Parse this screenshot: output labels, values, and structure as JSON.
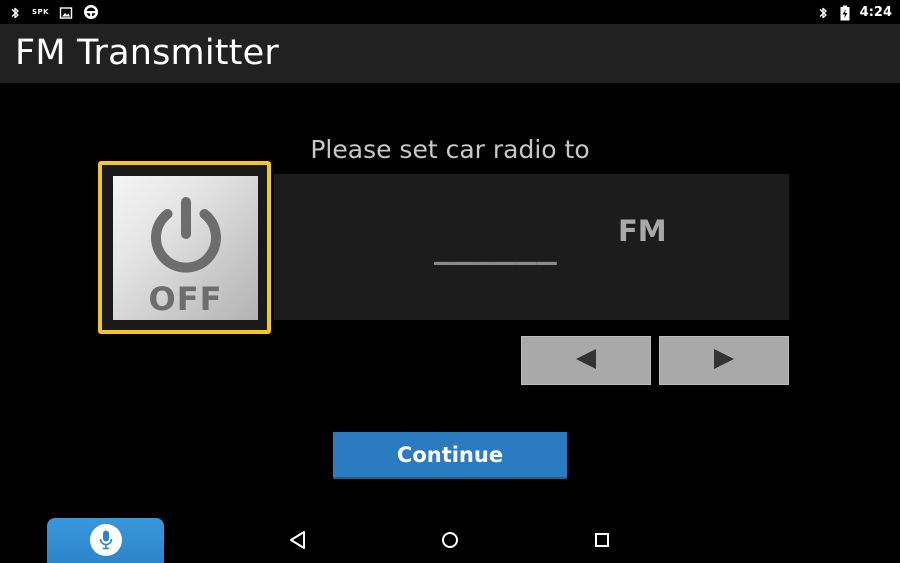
{
  "status_bar": {
    "left_icons": [
      "bluetooth-icon",
      "spk-icon",
      "image-icon",
      "steering-wheel-icon"
    ],
    "spk_text": "SPK",
    "right_icons": [
      "bluetooth-icon",
      "battery-charging-icon"
    ],
    "time": "4:24"
  },
  "app_bar": {
    "title": "FM Transmitter"
  },
  "main": {
    "prompt": "Please set car radio to",
    "power": {
      "icon": "power-icon",
      "state_label": "OFF",
      "highlight_color": "#f3c623"
    },
    "frequency": {
      "value": "______",
      "unit": "FM"
    },
    "tune_buttons": {
      "prev_icon": "triangle-left-icon",
      "next_icon": "triangle-right-icon"
    },
    "continue_label": "Continue",
    "accent_color": "#2a7bc0"
  },
  "nav_bar": {
    "voice_icon": "microphone-icon",
    "back_icon": "back-triangle-icon",
    "home_icon": "home-circle-icon",
    "recents_icon": "recents-square-icon"
  }
}
